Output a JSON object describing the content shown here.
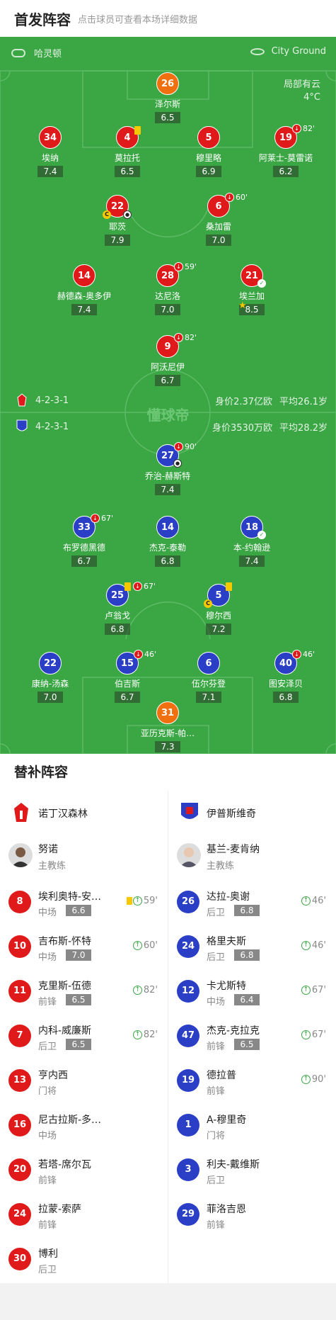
{
  "header": {
    "title": "首发阵容",
    "subtitle": "点击球员可查看本场详细数据"
  },
  "pitch": {
    "home_name": "哈灵顿",
    "venue": "City Ground",
    "weather": "局部有云",
    "temp": "4°C",
    "watermark": "懂球帝",
    "home_formation": "4-2-3-1",
    "home_value": "身价2.37亿欧",
    "home_age": "平均26.1岁",
    "away_formation": "4-2-3-1",
    "away_value": "身价3530万欧",
    "away_age": "平均28.2岁",
    "colors": {
      "home": "#e01a1a",
      "away": "#2a3fc6",
      "gk": "#f07010",
      "pitch": "#3aa644"
    }
  },
  "home_players": [
    {
      "num": "26",
      "name": "泽尔斯",
      "rating": "6.5"
    },
    {
      "num": "34",
      "name": "埃纳",
      "rating": "7.4"
    },
    {
      "num": "4",
      "name": "莫拉托",
      "rating": "6.5"
    },
    {
      "num": "5",
      "name": "穆里略",
      "rating": "6.9"
    },
    {
      "num": "19",
      "name": "阿莱士-莫雷诺",
      "rating": "6.2",
      "sub": "82'"
    },
    {
      "num": "22",
      "name": "耶茨",
      "rating": "7.9"
    },
    {
      "num": "6",
      "name": "桑加雷",
      "rating": "7.0",
      "sub": "60'"
    },
    {
      "num": "14",
      "name": "赫德森-奥多伊",
      "rating": "7.4"
    },
    {
      "num": "28",
      "name": "达尼洛",
      "rating": "7.0",
      "sub": "59'"
    },
    {
      "num": "21",
      "name": "埃兰加",
      "rating": "8.5"
    },
    {
      "num": "9",
      "name": "阿沃尼伊",
      "rating": "6.7",
      "sub": "82'"
    }
  ],
  "away_players": [
    {
      "num": "27",
      "name": "乔治-赫斯特",
      "rating": "7.4",
      "sub": "90'"
    },
    {
      "num": "33",
      "name": "布罗德黑德",
      "rating": "6.7",
      "sub": "67'"
    },
    {
      "num": "14",
      "name": "杰克-泰勒",
      "rating": "6.8"
    },
    {
      "num": "18",
      "name": "本-约翰逊",
      "rating": "7.4"
    },
    {
      "num": "25",
      "name": "卢翁戈",
      "rating": "6.8",
      "sub": "67'"
    },
    {
      "num": "5",
      "name": "穆尔西",
      "rating": "7.2"
    },
    {
      "num": "22",
      "name": "康纳-汤森",
      "rating": "7.0"
    },
    {
      "num": "15",
      "name": "伯吉斯",
      "rating": "6.7",
      "sub": "46'"
    },
    {
      "num": "6",
      "name": "伍尔芬登",
      "rating": "7.1"
    },
    {
      "num": "40",
      "name": "图安泽贝",
      "rating": "6.8",
      "sub": "46'"
    },
    {
      "num": "31",
      "name": "亚历克斯-帕…",
      "rating": "7.3"
    }
  ],
  "subs": {
    "title": "替补阵容",
    "home_team": "诺丁汉森林",
    "away_team": "伊普斯维奇",
    "home_coach": {
      "name": "努诺",
      "role": "主教练"
    },
    "away_coach": {
      "name": "基兰-麦肯纳",
      "role": "主教练"
    },
    "home": [
      {
        "num": "8",
        "name": "埃利奥特-安…",
        "pos": "中场",
        "rating": "6.6",
        "in": "59'"
      },
      {
        "num": "10",
        "name": "吉布斯-怀特",
        "pos": "中场",
        "rating": "7.0",
        "in": "60'"
      },
      {
        "num": "11",
        "name": "克里斯-伍德",
        "pos": "前锋",
        "rating": "6.5",
        "in": "82'"
      },
      {
        "num": "7",
        "name": "内科-威廉斯",
        "pos": "后卫",
        "rating": "6.5",
        "in": "82'"
      },
      {
        "num": "13",
        "name": "亨内西",
        "pos": "门将"
      },
      {
        "num": "16",
        "name": "尼古拉斯-多…",
        "pos": "中场"
      },
      {
        "num": "20",
        "name": "若塔-席尔瓦",
        "pos": "前锋"
      },
      {
        "num": "24",
        "name": "拉蒙-索萨",
        "pos": "前锋"
      },
      {
        "num": "30",
        "name": "博利",
        "pos": "后卫"
      }
    ],
    "away": [
      {
        "num": "26",
        "name": "达拉-奥谢",
        "pos": "后卫",
        "rating": "6.8",
        "in": "46'"
      },
      {
        "num": "24",
        "name": "格里夫斯",
        "pos": "后卫",
        "rating": "6.8",
        "in": "46'"
      },
      {
        "num": "12",
        "name": "卡尤斯特",
        "pos": "中场",
        "rating": "6.4",
        "in": "67'"
      },
      {
        "num": "47",
        "name": "杰克-克拉克",
        "pos": "前锋",
        "rating": "6.5",
        "in": "67'"
      },
      {
        "num": "19",
        "name": "德拉普",
        "pos": "前锋",
        "in": "90'"
      },
      {
        "num": "1",
        "name": "A-穆里奇",
        "pos": "门将"
      },
      {
        "num": "3",
        "name": "利夫-戴维斯",
        "pos": "后卫"
      },
      {
        "num": "29",
        "name": "菲洛吉恩",
        "pos": "前锋"
      }
    ]
  }
}
